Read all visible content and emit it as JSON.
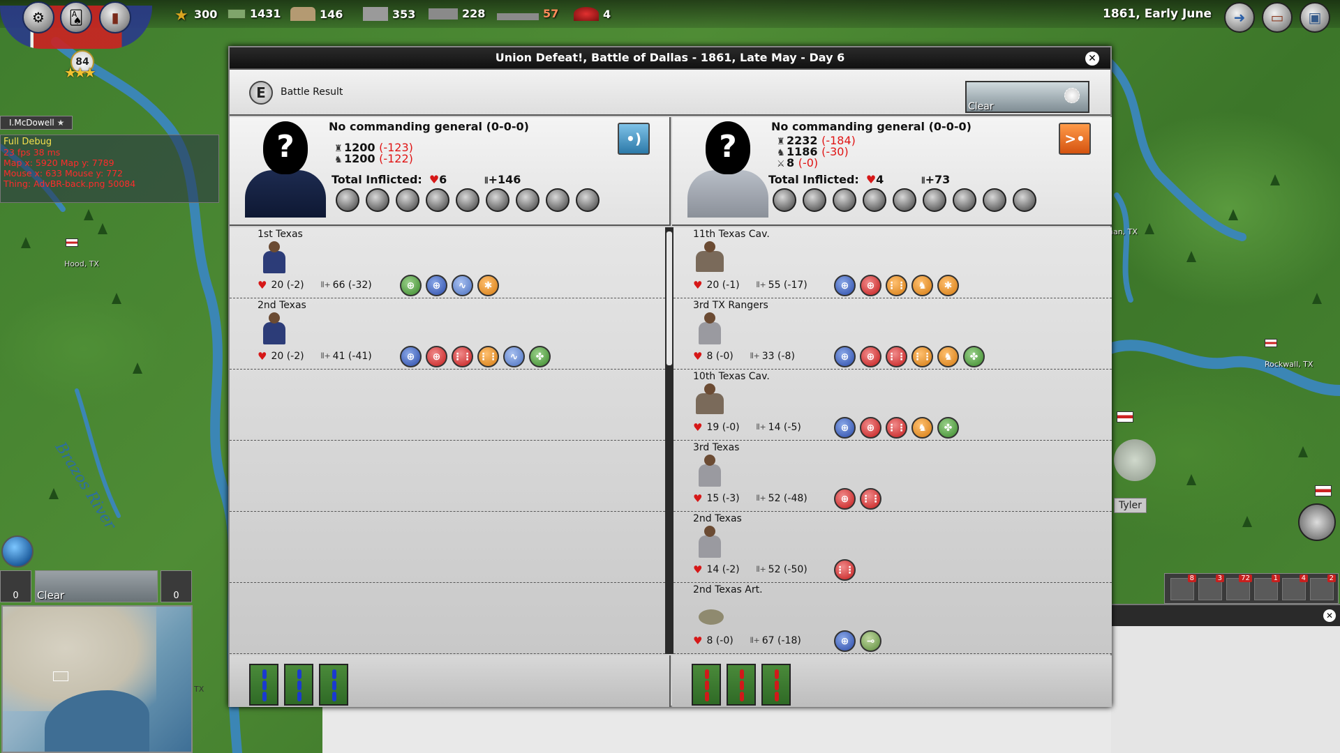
{
  "topbar": {
    "resources": [
      {
        "icon": "star-icon",
        "value": "300"
      },
      {
        "icon": "money-icon",
        "value": "1431"
      },
      {
        "icon": "recruits-icon",
        "value": "146"
      },
      {
        "icon": "supplies-icon",
        "value": "353"
      },
      {
        "icon": "train-icon",
        "value": "228"
      },
      {
        "icon": "ship-icon",
        "value": "57"
      },
      {
        "icon": "morale-icon",
        "value": "4"
      }
    ],
    "date": "1861, Early June",
    "level": "84"
  },
  "debug": {
    "general": "I.McDowell",
    "header": "Full Debug",
    "lines": [
      "23 fps 38 ms",
      "Map x: 5920 Map y: 7789",
      "Mouse x: 633 Mouse y: 772",
      "Thing: AdvBR-back.png 50084"
    ]
  },
  "map": {
    "hood_label": "Hood, TX",
    "brazos_label": "Brazos River",
    "tyler_label": "Tyler",
    "rockwall_label": "Rockwall, TX",
    "town_right": "nan, TX",
    "tx_label": "TX",
    "weather_left": {
      "label": "Clear",
      "left_count": "0",
      "right_count": "0"
    },
    "tray_counts": [
      "8",
      "3",
      "72",
      "1",
      "4",
      "2"
    ]
  },
  "dialog": {
    "title": "Union Defeat!, Battle of Dallas - 1861, Late May - Day 6",
    "result_label": "Battle Result",
    "result_badge": "E",
    "weather": "Clear",
    "union": {
      "general": "No commanding general (0-0-0)",
      "strength": [
        {
          "icon": "infantry-icon",
          "value": "1200",
          "loss": "(-123)"
        },
        {
          "icon": "cavalry-icon",
          "value": "1200",
          "loss": "(-122)"
        }
      ],
      "inflicted_label": "Total Inflicted:",
      "inflicted_hearts": "6",
      "inflicted_guns": "+146",
      "units": [
        {
          "name": "1st Texas",
          "hp": "20 (-2)",
          "mp": "66 (-32)",
          "abilities": [
            "green",
            "blue",
            "wave",
            "orange"
          ]
        },
        {
          "name": "2nd Texas",
          "hp": "20 (-2)",
          "mp": "41 (-41)",
          "abilities": [
            "blue",
            "red",
            "redgrid",
            "orangegrid",
            "wave",
            "clover"
          ]
        }
      ]
    },
    "csa": {
      "general": "No commanding general (0-0-0)",
      "strength": [
        {
          "icon": "infantry-icon",
          "value": "2232",
          "loss": "(-184)"
        },
        {
          "icon": "cavalry-icon",
          "value": "1186",
          "loss": "(-30)"
        },
        {
          "icon": "artillery-icon",
          "value": "8",
          "loss": "(-0)"
        }
      ],
      "inflicted_label": "Total Inflicted:",
      "inflicted_hearts": "4",
      "inflicted_guns": "+73",
      "units": [
        {
          "name": "11th Texas Cav.",
          "type": "cav",
          "hp": "20 (-1)",
          "mp": "55 (-17)",
          "abilities": [
            "blue",
            "red",
            "orangegrid",
            "rider",
            "orange"
          ]
        },
        {
          "name": "3rd TX Rangers",
          "type": "inf",
          "hp": "8 (-0)",
          "mp": "33 (-8)",
          "abilities": [
            "blue",
            "red",
            "redgrid",
            "orangegrid",
            "rider",
            "clover"
          ]
        },
        {
          "name": "10th Texas Cav.",
          "type": "cav",
          "hp": "19 (-0)",
          "mp": "14 (-5)",
          "abilities": [
            "blue",
            "red",
            "redgrid",
            "rider",
            "clover"
          ]
        },
        {
          "name": "3rd Texas",
          "type": "inf",
          "hp": "15 (-3)",
          "mp": "52 (-48)",
          "abilities": [
            "red",
            "redgrid"
          ]
        },
        {
          "name": "2nd Texas",
          "type": "inf",
          "hp": "14 (-2)",
          "mp": "52 (-50)",
          "abilities": [
            "redgrid"
          ]
        },
        {
          "name": "2nd Texas Art.",
          "type": "art",
          "hp": "8 (-0)",
          "mp": "67 (-18)",
          "abilities": [
            "blue",
            "cannon"
          ]
        }
      ]
    }
  },
  "colors": {
    "loss_red": "#e01414",
    "union_stack": "#1a3ad0",
    "csa_stack": "#d01a1a"
  }
}
